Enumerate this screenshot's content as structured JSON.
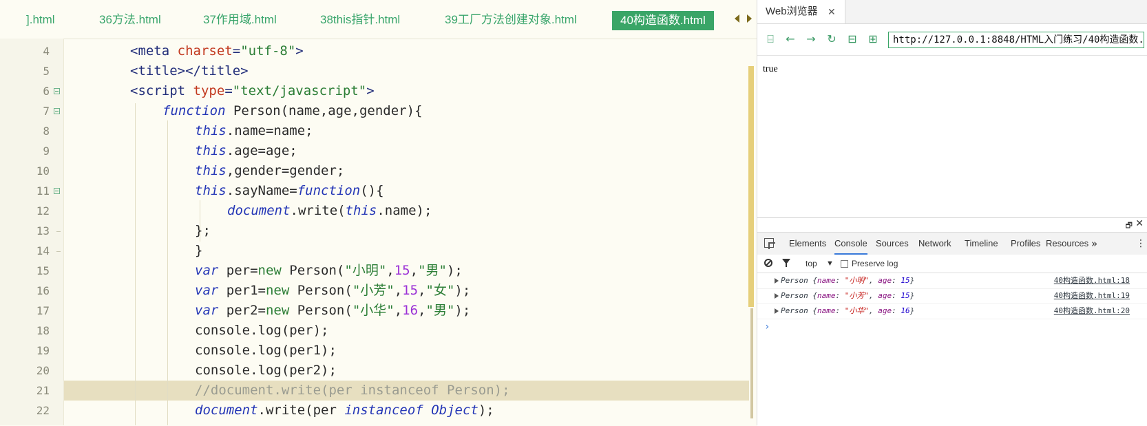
{
  "editor": {
    "tabs": [
      {
        "label": "].html"
      },
      {
        "label": "36方法.html"
      },
      {
        "label": "37作用域.html"
      },
      {
        "label": "38this指针.html"
      },
      {
        "label": "39工厂方法创建对象.html"
      },
      {
        "label": "40构造函数.html",
        "active": true
      }
    ],
    "line_numbers": [
      "4",
      "5",
      "6",
      "7",
      "8",
      "9",
      "10",
      "11",
      "12",
      "13",
      "14",
      "15",
      "16",
      "17",
      "18",
      "19",
      "20",
      "21",
      "22"
    ],
    "code": {
      "l4": {
        "open": "<",
        "tag": "meta",
        "attr": "charset",
        "eq": "=",
        "val": "\"utf-8\"",
        "close": ">"
      },
      "l5": {
        "text": "<title></title>"
      },
      "l6": {
        "open": "<",
        "tag": "script",
        "attr": "type",
        "eq": "=",
        "val": "\"text/javascript\"",
        "close": ">"
      },
      "l7": {
        "kw": "function",
        "rest": " Person(name,age,gender){"
      },
      "l8": {
        "kw": "this",
        "rest": ".name=name;"
      },
      "l9": {
        "kw": "this",
        "rest": ".age=age;"
      },
      "l10": {
        "kw": "this",
        "rest": ",gender=gender;"
      },
      "l11": {
        "kw": "this",
        "mid": ".sayName=",
        "kw2": "function",
        "rest": "(){"
      },
      "l12": {
        "kw": "document",
        "mid": ".write(",
        "kw2": "this",
        "rest": ".name);"
      },
      "l13": {
        "text": "};"
      },
      "l14": {
        "text": "}"
      },
      "l15": {
        "kw": "var",
        "a": " per=",
        "new": "new",
        "b": " Person(",
        "s1": "\"小明\"",
        "c1": ",",
        "n": "15",
        "c2": ",",
        "s2": "\"男\"",
        "end": ");"
      },
      "l16": {
        "kw": "var",
        "a": " per1=",
        "new": "new",
        "b": " Person(",
        "s1": "\"小芳\"",
        "c1": ",",
        "n": "15",
        "c2": ",",
        "s2": "\"女\"",
        "end": ");"
      },
      "l17": {
        "kw": "var",
        "a": " per2=",
        "new": "new",
        "b": " Person(",
        "s1": "\"小华\"",
        "c1": ",",
        "n": "16",
        "c2": ",",
        "s2": "\"男\"",
        "end": ");"
      },
      "l18": {
        "text": "console.log(per);"
      },
      "l19": {
        "text": "console.log(per1);"
      },
      "l20": {
        "text": "console.log(per2);"
      },
      "l21": {
        "text": "//document.write(per instanceof Person);"
      },
      "l22": {
        "kw": "document",
        "mid": ".write(per ",
        "kw2": "instanceof",
        "sp": " ",
        "kw3": "Object",
        "rest": ");"
      }
    }
  },
  "browser": {
    "tab_label": "Web浏览器",
    "tab_close": "✕",
    "url": "http://127.0.0.1:8848/HTML入门练习/40构造函数.",
    "page_text": "true",
    "nav": {
      "console": "⌸",
      "back": "←",
      "forward": "→",
      "reload": "↻",
      "lock": "⊟",
      "qr": "⊞"
    }
  },
  "devtools": {
    "undock": "🗗",
    "close": "✕",
    "tabs": [
      "Elements",
      "Console",
      "Sources",
      "Network",
      "Timeline",
      "Profiles",
      "Resources"
    ],
    "active_tab": "Console",
    "more": "»",
    "menu": "⋮",
    "context": "top",
    "context_caret": "▼",
    "preserve_log": "Preserve log",
    "entries": [
      {
        "cls": "Person",
        "open": " {",
        "k1": "name",
        "c1": ": ",
        "v1": "\"小明\"",
        "c2": ", ",
        "k2": "age",
        "c3": ": ",
        "v2": "15",
        "close": "}",
        "source": "40构造函数.html:18"
      },
      {
        "cls": "Person",
        "open": " {",
        "k1": "name",
        "c1": ": ",
        "v1": "\"小芳\"",
        "c2": ", ",
        "k2": "age",
        "c3": ": ",
        "v2": "15",
        "close": "}",
        "source": "40构造函数.html:19"
      },
      {
        "cls": "Person",
        "open": " {",
        "k1": "name",
        "c1": ": ",
        "v1": "\"小华\"",
        "c2": ", ",
        "k2": "age",
        "c3": ": ",
        "v2": "16",
        "close": "}",
        "source": "40构造函数.html:20"
      }
    ],
    "prompt": "›"
  }
}
